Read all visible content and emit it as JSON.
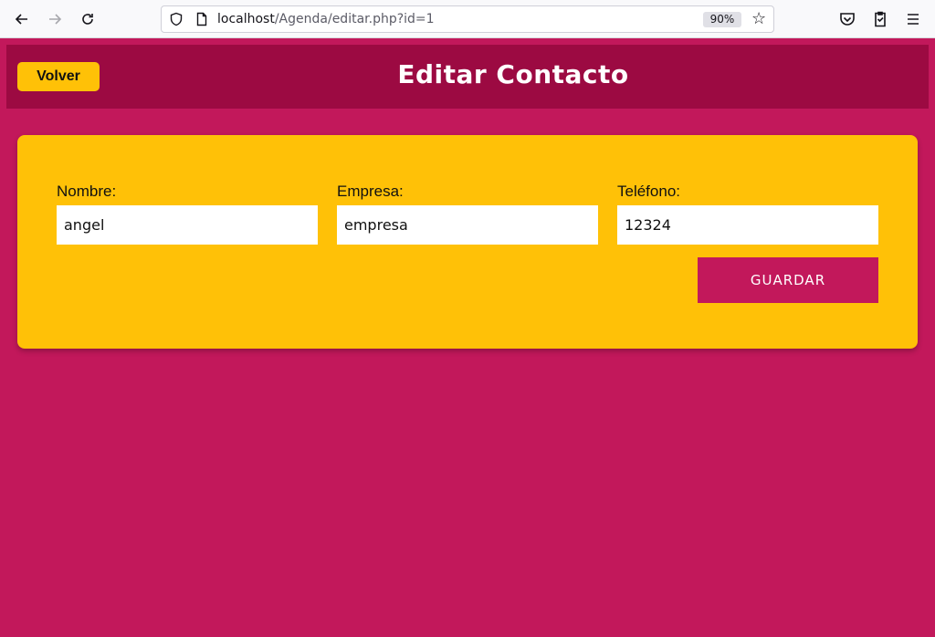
{
  "browser": {
    "url_host": "localhost",
    "url_path": "/Agenda/editar.php?id=1",
    "zoom": "90%",
    "icons": [
      "back-arrow-icon",
      "forward-arrow-icon",
      "reload-icon",
      "shield-icon",
      "page-icon",
      "star-icon",
      "pocket-icon",
      "clipboard-icon",
      "menu-icon"
    ]
  },
  "header": {
    "back_label": "Volver",
    "title": "Editar Contacto"
  },
  "form": {
    "fields": [
      {
        "label": "Nombre:",
        "value": "angel"
      },
      {
        "label": "Empresa:",
        "value": "empresa"
      },
      {
        "label": "Teléfono:",
        "value": "12324"
      }
    ],
    "submit_label": "GUARDAR"
  },
  "colors": {
    "page_bg": "#c2185b",
    "header_bg": "#9c0a42",
    "card_bg": "#ffc107",
    "button_bg": "#c2185b"
  }
}
